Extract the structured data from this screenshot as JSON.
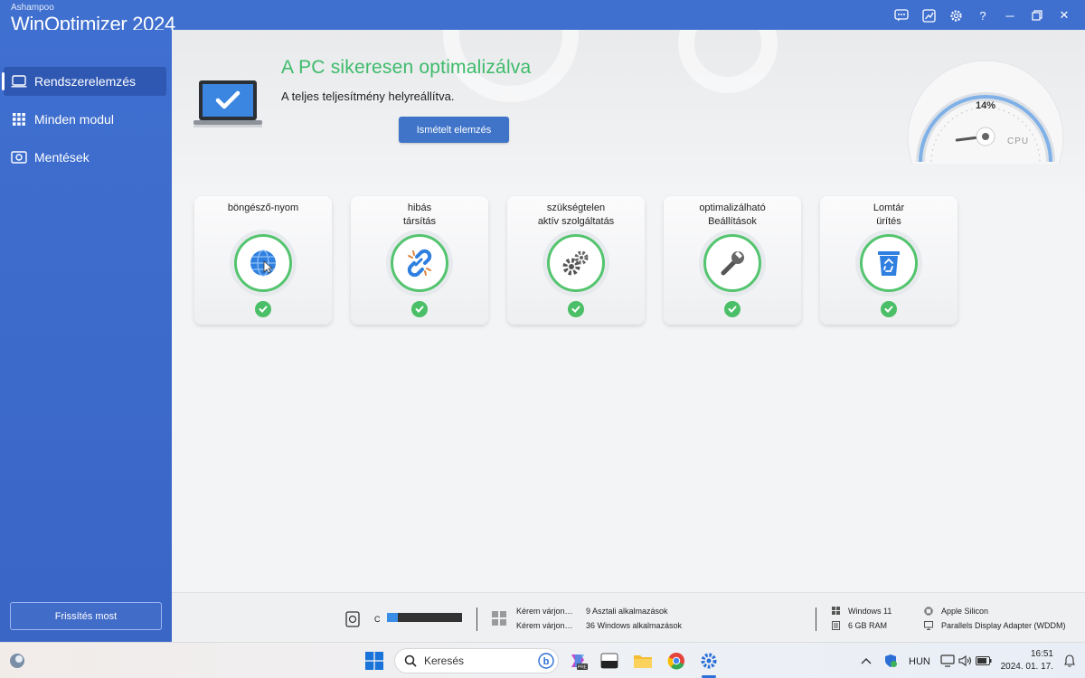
{
  "app": {
    "brand_small": "Ashampoo",
    "brand_name": "WinOptimizer 2024"
  },
  "titlebar_icons": [
    "feedback-icon",
    "chart-icon",
    "settings-icon",
    "help-icon",
    "minimize-icon",
    "restore-icon",
    "close-icon"
  ],
  "titlebar_labels": {
    "help": "?",
    "minimize": "─",
    "close": "✕"
  },
  "sidebar": {
    "items": [
      {
        "label": "Rendszerelemzés",
        "icon": "monitor-icon",
        "active": true
      },
      {
        "label": "Minden modul",
        "icon": "grid-icon",
        "active": false
      },
      {
        "label": "Mentések",
        "icon": "backup-icon",
        "active": false
      }
    ],
    "update_button": "Frissítés most"
  },
  "hero": {
    "title": "A PC sikeresen optimalizálva",
    "subtitle": "A teljes teljesítmény helyreállítva.",
    "rescan_button": "Ismételt elemzés"
  },
  "gauge": {
    "value": "14%",
    "label": "CPU",
    "fraction": 0.14
  },
  "cards": [
    {
      "label": "böngésző-nyom",
      "icon": "globe-icon",
      "status": "ok"
    },
    {
      "label": "hibás\ntársítás",
      "icon": "broken-link-icon",
      "status": "ok"
    },
    {
      "label": "szükségtelen\naktív szolgáltatás",
      "icon": "gears-icon",
      "status": "ok"
    },
    {
      "label": "optimalizálható\nBeállítások",
      "icon": "wrench-icon",
      "status": "ok"
    },
    {
      "label": "Lomtár\nürítés",
      "icon": "recycle-bin-icon",
      "status": "ok"
    }
  ],
  "statusbar": {
    "drive_letter": "C",
    "drive_fill": 0.15,
    "wait1": "Kérem várjon…",
    "wait2": "Kérem várjon…",
    "desktop_apps": "9 Asztali alkalmazások",
    "windows_apps": "36 Windows alkalmazások",
    "os": "Windows 11",
    "ram": "6 GB RAM",
    "cpu": "Apple Silicon",
    "gpu": "Parallels Display Adapter (WDDM)"
  },
  "taskbar": {
    "search_placeholder": "Keresés",
    "lang": "HUN",
    "time": "16:51",
    "date": "2024. 01. 17."
  },
  "colors": {
    "accent": "#3f6fcf",
    "success": "#3dbb6a",
    "button": "#3f74c9"
  }
}
